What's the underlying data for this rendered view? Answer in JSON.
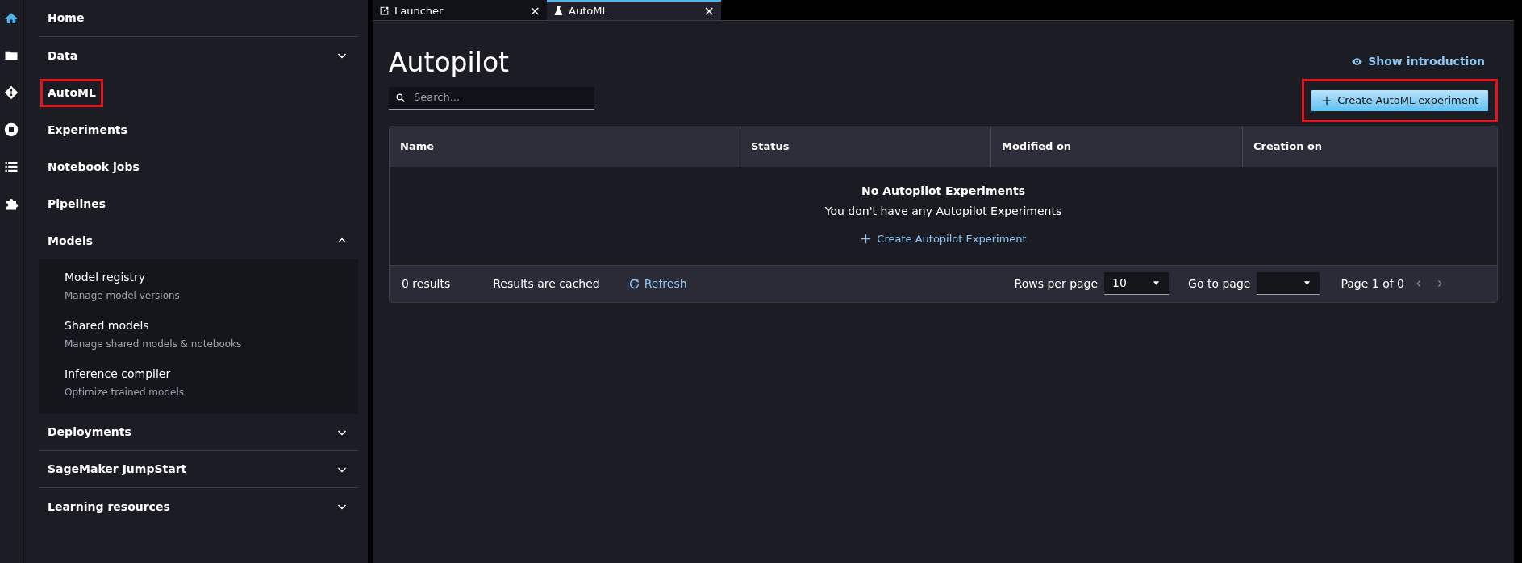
{
  "icon_rail": [
    {
      "kind": "home",
      "selected": true
    },
    {
      "kind": "folder",
      "selected": false
    },
    {
      "kind": "git",
      "selected": false
    },
    {
      "kind": "stop",
      "selected": false
    },
    {
      "kind": "list",
      "selected": false
    },
    {
      "kind": "puzzle",
      "selected": false
    }
  ],
  "sidebar": {
    "items": [
      {
        "label": "Home",
        "kind": "link",
        "highlighted": false,
        "divider": true
      },
      {
        "label": "Data",
        "kind": "section",
        "expanded": false,
        "highlighted": false,
        "divider": false
      },
      {
        "label": "AutoML",
        "kind": "link",
        "highlighted": true,
        "divider": false
      },
      {
        "label": "Experiments",
        "kind": "link",
        "highlighted": false,
        "divider": false
      },
      {
        "label": "Notebook jobs",
        "kind": "link",
        "highlighted": false,
        "divider": false
      },
      {
        "label": "Pipelines",
        "kind": "link",
        "highlighted": false,
        "divider": false
      },
      {
        "label": "Models",
        "kind": "section",
        "expanded": true,
        "highlighted": false,
        "divider": false,
        "children": [
          {
            "label": "Model registry",
            "description": "Manage model versions"
          },
          {
            "label": "Shared models",
            "description": "Manage shared models & notebooks"
          },
          {
            "label": "Inference compiler",
            "description": "Optimize trained models"
          }
        ]
      },
      {
        "label": "Deployments",
        "kind": "section",
        "expanded": false,
        "highlighted": false,
        "divider": true
      },
      {
        "label": "SageMaker JumpStart",
        "kind": "section",
        "expanded": false,
        "highlighted": false,
        "divider": true
      },
      {
        "label": "Learning resources",
        "kind": "section",
        "expanded": false,
        "highlighted": false,
        "divider": false
      }
    ]
  },
  "tabs": [
    {
      "label": "Launcher",
      "kind": "launcher",
      "selected": false,
      "close": "×"
    },
    {
      "label": "AutoML",
      "kind": "flask",
      "selected": true,
      "close": "×"
    }
  ],
  "page": {
    "title": "Autopilot",
    "show_introduction": "Show introduction",
    "search": {
      "placeholder": "Search..."
    },
    "create_button": {
      "label": "Create AutoML experiment",
      "highlighted": true
    },
    "table": {
      "columns": [
        "Name",
        "Status",
        "Modified on",
        "Creation on"
      ],
      "empty": {
        "title": "No Autopilot Experiments",
        "message": "You don't have any Autopilot Experiments",
        "action": "Create Autopilot Experiment"
      },
      "footer": {
        "results": "0 results",
        "cached": "Results are cached",
        "refresh": "Refresh",
        "rows_per_page_label": "Rows per page",
        "rows_per_page_value": "10",
        "go_to_page_label": "Go to page",
        "page_info": "Page 1 of 0"
      }
    }
  }
}
